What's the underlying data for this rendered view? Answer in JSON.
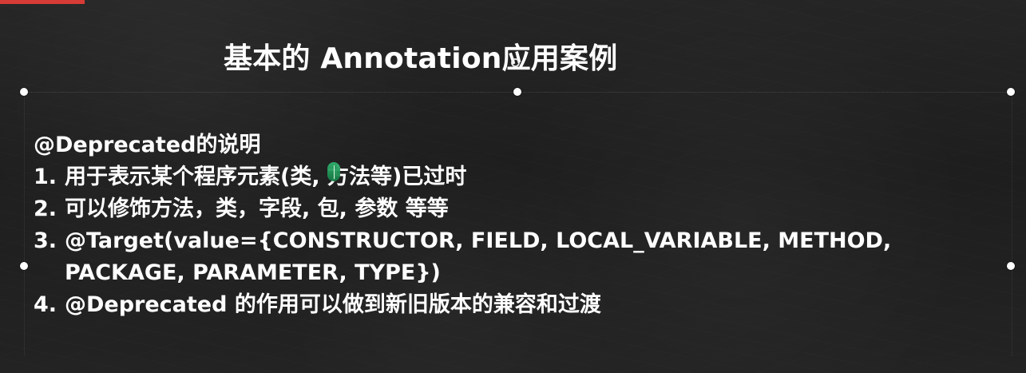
{
  "slide": {
    "title": "基本的 Annotation应用案例",
    "lines": [
      "@Deprecated的说明",
      {
        "number": "1.",
        "text": "用于表示某个程序元素(类, 方法等)已过时"
      },
      {
        "number": "2.",
        "text": "可以修饰方法，类，字段, 包, 参数  等等"
      },
      {
        "number": "3.",
        "text": "@Target(value={CONSTRUCTOR, FIELD, LOCAL_VARIABLE, METHOD, PACKAGE, PARAMETER, TYPE})"
      },
      {
        "number": "4.",
        "text": "@Deprecated 的作用可以做到新旧版本的兼容和过渡"
      }
    ]
  },
  "colors": {
    "background": "#202020",
    "text": "#ffffff",
    "accent": "#d63b35",
    "caret": "#31b36f"
  },
  "icons": {
    "selection_handles": "circle-handle-icon",
    "mouse_pointer": "cursor-ring-icon",
    "text_caret": "text-caret-icon"
  }
}
